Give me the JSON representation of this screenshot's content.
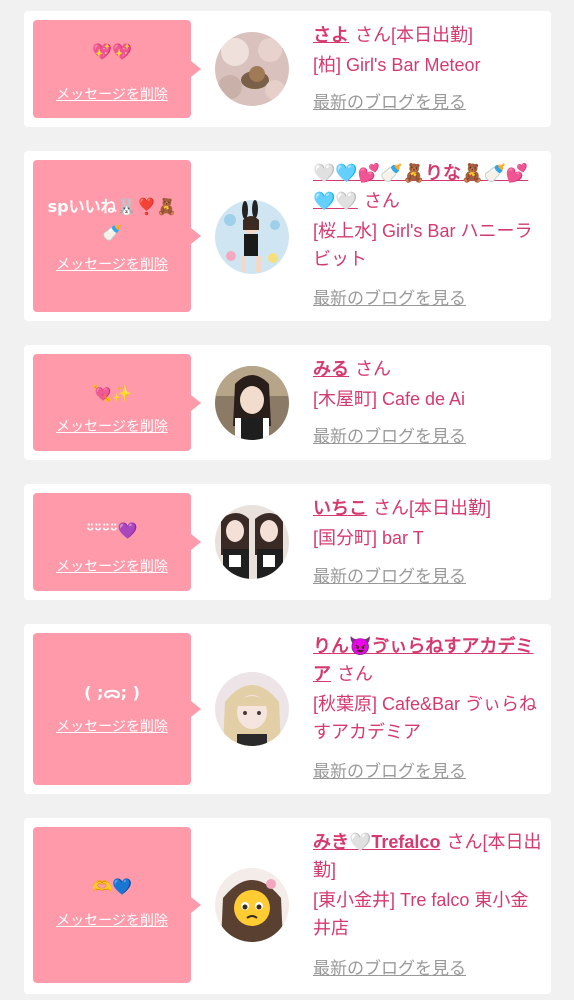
{
  "common": {
    "delete_label": "メッセージを削除",
    "blog_label": "最新のブログを見る",
    "san_suffix": "さん"
  },
  "colors": {
    "bubble": "#ff9aaa",
    "accent": "#d63a6d",
    "link_gray": "#999999",
    "background": "#f1f1f1"
  },
  "cards": [
    {
      "message": "💖💖",
      "name": "さよ",
      "suffix": "さん[本日出勤]",
      "shop": "[柏] Girl's Bar Meteor",
      "avatar_icon": "snail-photo-avatar"
    },
    {
      "message": "spいいね🐰❣️🧸🍼",
      "name": "🤍🩵💕🍼🧸りな🧸🍼💕🩵🤍",
      "suffix": "さん",
      "shop": "[桜上水] Girl's Bar ハニーラビット",
      "avatar_icon": "bunny-girl-avatar"
    },
    {
      "message": "💘✨",
      "name": "みる",
      "suffix": "さん",
      "shop": "[木屋町] Cafe de Ai",
      "avatar_icon": "girl-photo-avatar"
    },
    {
      "message": "ᵕ̈ᵕ̈ᵕ̈ᵕ̈💜",
      "name": "いちこ",
      "suffix": "さん[本日出勤]",
      "shop": "[国分町] bar T",
      "avatar_icon": "maid-photo-avatar"
    },
    {
      "message": "( ;ᯅ; )",
      "name": "りん😈ゔぃらねすアカデミア",
      "suffix": "さん",
      "shop": "[秋葉原] Cafe&Bar ゔぃらねすアカデミア",
      "avatar_icon": "blonde-girl-avatar"
    },
    {
      "message": "🫶💙",
      "name": "みき🤍Trefalco",
      "suffix": "さん[本日出勤]",
      "shop": "[東小金井] Tre falco 東小金井店",
      "avatar_icon": "emoji-face-avatar"
    }
  ]
}
